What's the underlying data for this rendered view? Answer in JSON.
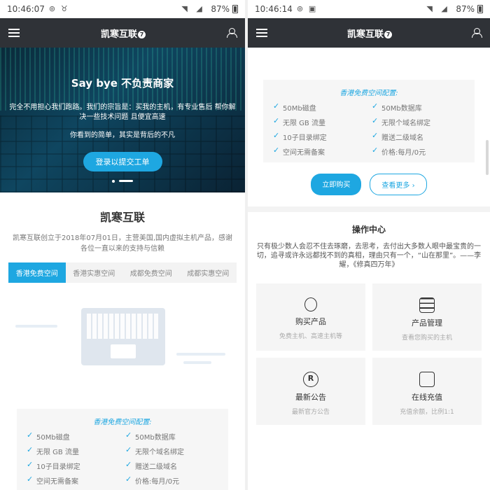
{
  "left": {
    "status": {
      "time": "10:46:07",
      "battery": "87%"
    },
    "nav": {
      "title": "凯寒互联"
    },
    "hero": {
      "title": "Say bye 不负责商家",
      "line1": "完全不用担心我们跑路。我们的宗旨是：买我的主机，有专业售后 帮你解决一些技术问题 且便宜高速",
      "line2": "你看到的简单，其实是背后的不凡",
      "cta": "登录以提交工单"
    },
    "about": {
      "title": "凯寒互联",
      "text": "凯寒互联创立于2018年07月01日，主营美国,国内虚拟主机产品，感谢各位一直以来的支持与信赖"
    },
    "tabs": [
      "香港免费空间",
      "香港实惠空间",
      "成都免费空间",
      "成都实惠空间"
    ],
    "config": {
      "title": "香港免费空间配置:",
      "items": [
        "50Mb磁盘",
        "50Mb数据库",
        "无限 GB 流量",
        "无限个域名绑定",
        "10子目录绑定",
        "赠送二级域名",
        "空间无需备案",
        "价格:每月/0元"
      ]
    }
  },
  "right": {
    "status": {
      "time": "10:46:14",
      "battery": "87%"
    },
    "nav": {
      "title": "凯寒互联"
    },
    "config": {
      "title": "香港免费空间配置:",
      "items": [
        "50Mb磁盘",
        "50Mb数据库",
        "无限 GB 流量",
        "无限个域名绑定",
        "10子目录绑定",
        "赠送二级域名",
        "空间无需备案",
        "价格:每月/0元"
      ]
    },
    "buttons": {
      "buy": "立即购买",
      "more": "查看更多 ›"
    },
    "ops": {
      "title": "操作中心",
      "text": "只有极少数人会忍不住去琢磨，去思考，去付出大多数人眼中最宝贵的一切，追寻或许永远都找不到的真相，理由只有一个，“山在那里”。——李耀，《修真四万年》"
    },
    "cards": [
      {
        "title": "购买产品",
        "sub": "免费主机、高速主机等"
      },
      {
        "title": "产品管理",
        "sub": "查看您购买的主机"
      },
      {
        "title": "最新公告",
        "sub": "最新官方公告"
      },
      {
        "title": "在线充值",
        "sub": "充值余额，比例1:1"
      }
    ]
  }
}
